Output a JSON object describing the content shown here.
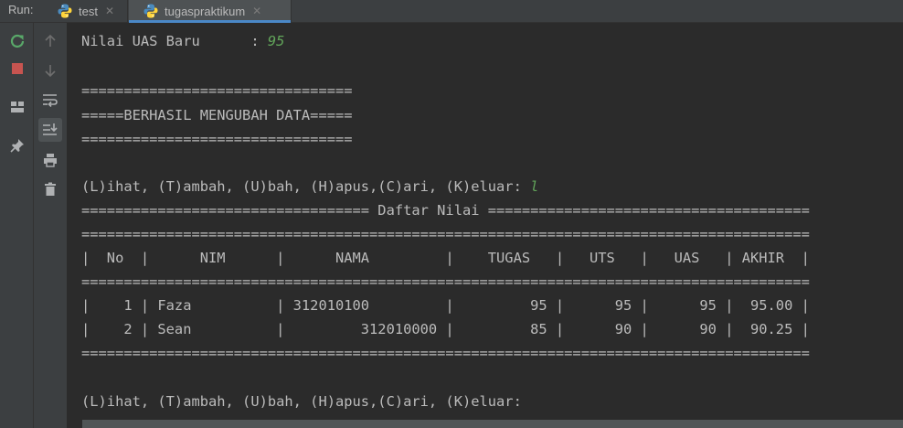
{
  "run_label": "Run:",
  "tabs": [
    {
      "label": "test",
      "close": "✕"
    },
    {
      "label": "tugaspraktikum",
      "close": "✕"
    }
  ],
  "toolbar": {
    "left_icons": [
      "rerun-icon",
      "stop-icon",
      "layout-icon",
      "pin-icon"
    ],
    "right_icons": [
      "up-arrow-icon",
      "down-arrow-icon",
      "soft-wrap-icon",
      "scroll-to-end-icon",
      "print-icon",
      "trash-icon"
    ]
  },
  "console": {
    "l1_prefix": "Nilai UAS Baru      : ",
    "l1_input": "95",
    "l2": "================================",
    "l3": "=====BERHASIL MENGUBAH DATA=====",
    "l4": "================================",
    "l5_prefix": "(L)ihat, (T)ambah, (U)bah, (H)apus,(C)ari, (K)eluar: ",
    "l5_input": "l",
    "l6": "================================== Daftar Nilai ======================================",
    "l7": "======================================================================================",
    "l8": "|  No  |      NIM      |      NAMA         |    TUGAS   |   UTS   |   UAS   | AKHIR  |",
    "l9": "======================================================================================",
    "l10": "|    1 | Faza          | 312010100         |         95 |      95 |      95 |  95.00 |",
    "l11": "|    2 | Sean          |         312010000 |         85 |      90 |      90 |  90.25 |",
    "l12": "======================================================================================",
    "l13": "(L)ihat, (T)ambah, (U)bah, (H)apus,(C)ari, (K)eluar: "
  }
}
